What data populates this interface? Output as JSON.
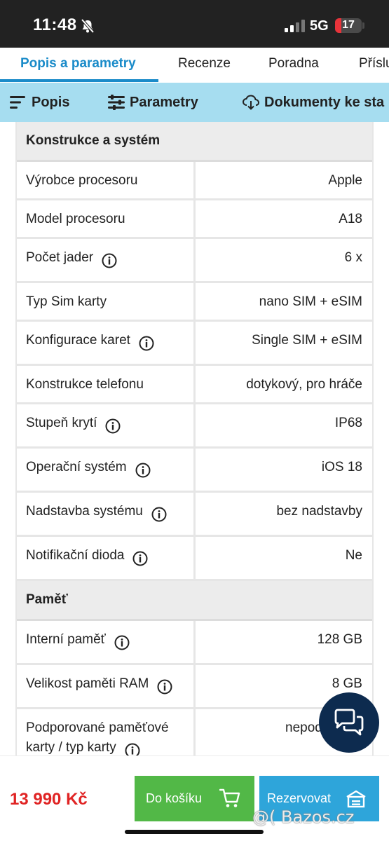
{
  "status_bar": {
    "time": "11:48",
    "network": "5G",
    "battery": "17"
  },
  "tabs": [
    {
      "label": "Popis a parametry",
      "active": true
    },
    {
      "label": "Recenze"
    },
    {
      "label": "Poradna"
    },
    {
      "label": "Příslu"
    }
  ],
  "subnav": [
    {
      "label": "Popis",
      "icon": "menu-icon"
    },
    {
      "label": "Parametry",
      "icon": "sliders-icon"
    },
    {
      "label": "Dokumenty ke sta",
      "icon": "cloud-download-icon"
    }
  ],
  "sections": [
    {
      "title": "Konstrukce a systém",
      "rows": [
        {
          "label": "Výrobce procesoru",
          "value": "Apple"
        },
        {
          "label": "Model procesoru",
          "value": "A18"
        },
        {
          "label": "Počet jader",
          "value": "6 x"
        },
        {
          "label": "Typ Sim karty",
          "value": "nano SIM + eSIM"
        },
        {
          "label": "Konfigurace karet",
          "value": "Single SIM + eSIM"
        },
        {
          "label": "Konstrukce telefonu",
          "value": "dotykový, pro hráče"
        },
        {
          "label": "Stupeň krytí",
          "value": "IP68"
        },
        {
          "label": "Operační systém",
          "value": "iOS 18"
        },
        {
          "label": "Nadstavba systému",
          "value": "bez nadstavby"
        },
        {
          "label": "Notifikační dioda",
          "value": "Ne"
        }
      ]
    },
    {
      "title": "Paměť",
      "rows": [
        {
          "label": "Interní paměť",
          "value": "128 GB"
        },
        {
          "label": "Velikost paměti RAM",
          "value": "8 GB"
        },
        {
          "label_line1": "Podporované paměťové",
          "label_line2": "karty / typ karty",
          "value": "nepod"
        }
      ]
    }
  ],
  "bottom_bar": {
    "price": "13 990 Kč",
    "cart_label": "Do košíku",
    "reserve_label": "Rezervovat"
  },
  "watermark": "@( Bazos.cz",
  "colors": {
    "accent": "#1a8bc9",
    "subnav_bg": "#a6ddf0",
    "cart_green": "#52b847",
    "reserve_blue": "#2ea5da",
    "price_red": "#e02424"
  }
}
